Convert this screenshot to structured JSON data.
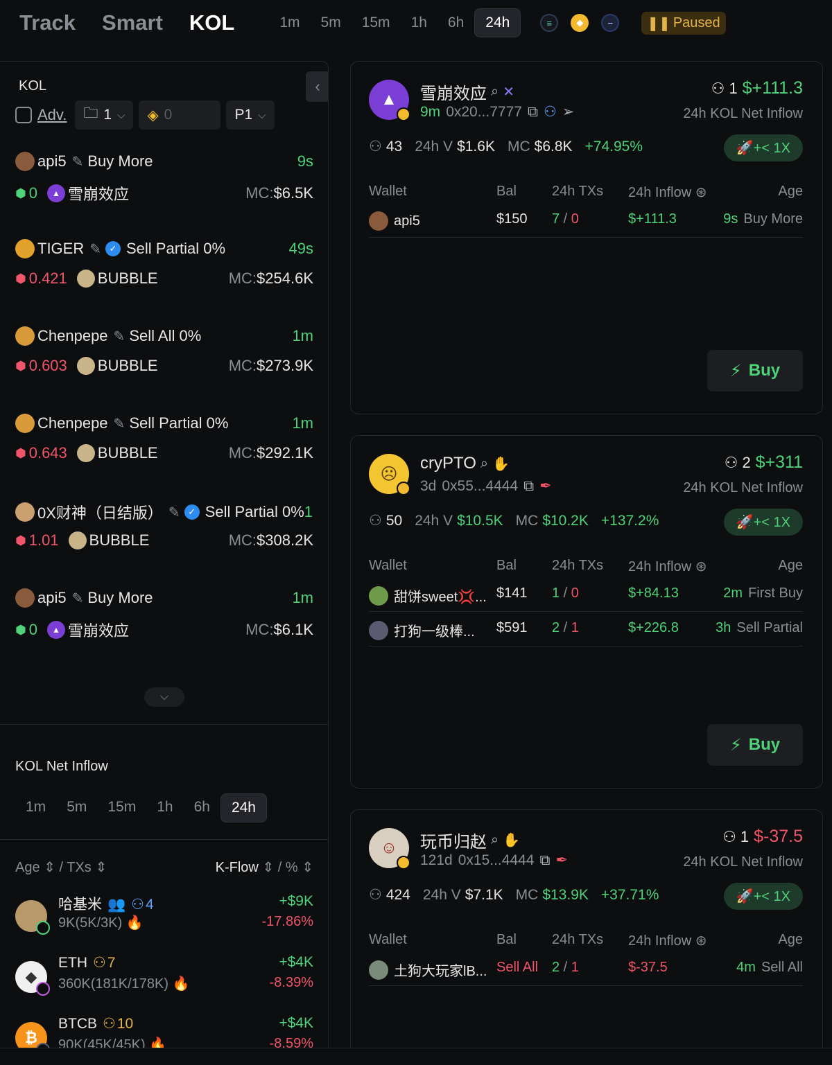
{
  "topbar": {
    "tabs": [
      "Track",
      "Smart",
      "KOL"
    ],
    "timeframes": [
      "1m",
      "5m",
      "15m",
      "1h",
      "6h",
      "24h"
    ],
    "paused_label": "Paused"
  },
  "left": {
    "title": "KOL",
    "adv_label": "Adv.",
    "folder_value": "1",
    "bnb_value": "0",
    "page_select": "P1",
    "feed": [
      {
        "name": "api5",
        "action": "Buy More",
        "time": "9s",
        "amount": "0",
        "amount_color": "green",
        "token": "雪崩效应",
        "mc_label": "MC:",
        "mc": "$6.5K",
        "verified": false
      },
      {
        "name": "TIGER",
        "action": "Sell Partial 0%",
        "time": "49s",
        "amount": "0.421",
        "amount_color": "red",
        "token": "BUBBLE",
        "mc_label": "MC:",
        "mc": "$254.6K",
        "verified": true
      },
      {
        "name": "Chenpepe",
        "action": "Sell All 0%",
        "time": "1m",
        "amount": "0.603",
        "amount_color": "red",
        "token": "BUBBLE",
        "mc_label": "MC:",
        "mc": "$273.9K",
        "verified": false
      },
      {
        "name": "Chenpepe",
        "action": "Sell Partial 0%",
        "time": "1m",
        "amount": "0.643",
        "amount_color": "red",
        "token": "BUBBLE",
        "mc_label": "MC:",
        "mc": "$292.1K",
        "verified": false
      },
      {
        "name": "0X财神（日结版）",
        "action": "Sell Partial 0%",
        "time": "1",
        "amount": "1.01",
        "amount_color": "red",
        "token": "BUBBLE",
        "mc_label": "MC:",
        "mc": "$308.2K",
        "verified": true
      },
      {
        "name": "api5",
        "action": "Buy More",
        "time": "1m",
        "amount": "0",
        "amount_color": "green",
        "token": "雪崩效应",
        "mc_label": "MC:",
        "mc": "$6.1K",
        "verified": false
      }
    ],
    "inflow": {
      "title": "KOL Net Inflow",
      "timeframes": [
        "1m",
        "5m",
        "15m",
        "1h",
        "6h",
        "24h"
      ],
      "head_age": "Age",
      "head_sep": "/",
      "head_txs": "TXs",
      "head_kflow": "K-Flow",
      "head_pct": "%",
      "rows": [
        {
          "name": "哈基米",
          "kol_count": "4",
          "txs": "9K(5K/3K)",
          "kflow": "+$9K",
          "pct": "-17.86%"
        },
        {
          "name": "ETH",
          "kol_count": "7",
          "txs": "360K(181K/178K)",
          "kflow": "+$4K",
          "pct": "-8.39%"
        },
        {
          "name": "BTCB",
          "kol_count": "10",
          "txs": "90K(45K/45K)",
          "kflow": "+$4K",
          "pct": "-8.59%"
        }
      ]
    }
  },
  "cards": [
    {
      "name": "雪崩效应",
      "age": "9m",
      "address": "0x20...7777",
      "kol_count": "1",
      "net_inflow": "$+111.3",
      "inflow_sign": "pos",
      "inflow_label": "24h KOL Net Inflow",
      "holders": "43",
      "vol_label": "24h V",
      "vol": "$1.6K",
      "mc_label": "MC",
      "mc": "$6.8K",
      "change": "+74.95%",
      "rocket": "+< 1X",
      "headers": {
        "wallet": "Wallet",
        "bal": "Bal",
        "txs": "24h TXs",
        "inflow": "24h Inflow",
        "age": "Age"
      },
      "wallets": [
        {
          "name": "api5",
          "bal": "$150",
          "buys": "7",
          "sells": "0",
          "inflow": "$+111.3",
          "inflow_sign": "pos",
          "age": "9s",
          "action": "Buy More"
        }
      ],
      "buy_label": "Buy"
    },
    {
      "name": "cryPTO",
      "age": "3d",
      "address": "0x55...4444",
      "kol_count": "2",
      "net_inflow": "$+311",
      "inflow_sign": "pos",
      "inflow_label": "24h KOL Net Inflow",
      "holders": "50",
      "vol_label": "24h V",
      "vol": "$10.5K",
      "mc_label": "MC",
      "mc": "$10.2K",
      "change": "+137.2%",
      "rocket": "+< 1X",
      "headers": {
        "wallet": "Wallet",
        "bal": "Bal",
        "txs": "24h TXs",
        "inflow": "24h Inflow",
        "age": "Age"
      },
      "wallets": [
        {
          "name": "甜饼sweet💢...",
          "bal": "$141",
          "buys": "1",
          "sells": "0",
          "inflow": "$+84.13",
          "inflow_sign": "pos",
          "age": "2m",
          "action": "First Buy"
        },
        {
          "name": "打狗一级棒...",
          "bal": "$591",
          "buys": "2",
          "sells": "1",
          "inflow": "$+226.8",
          "inflow_sign": "pos",
          "age": "3h",
          "action": "Sell Partial"
        }
      ],
      "buy_label": "Buy"
    },
    {
      "name": "玩币归赵",
      "age": "121d",
      "address": "0x15...4444",
      "kol_count": "1",
      "net_inflow": "$-37.5",
      "inflow_sign": "neg",
      "inflow_label": "24h KOL Net Inflow",
      "holders": "424",
      "vol_label": "24h V",
      "vol": "$7.1K",
      "mc_label": "MC",
      "mc": "$13.9K",
      "change": "+37.71%",
      "rocket": "+< 1X",
      "headers": {
        "wallet": "Wallet",
        "bal": "Bal",
        "txs": "24h TXs",
        "inflow": "24h Inflow",
        "age": "Age"
      },
      "wallets": [
        {
          "name": "土狗大玩家lB...",
          "bal": "Sell All",
          "bal_red": true,
          "buys": "2",
          "sells": "1",
          "inflow": "$-37.5",
          "inflow_sign": "neg",
          "age": "4m",
          "action": "Sell All"
        }
      ],
      "buy_label": "Buy"
    }
  ]
}
